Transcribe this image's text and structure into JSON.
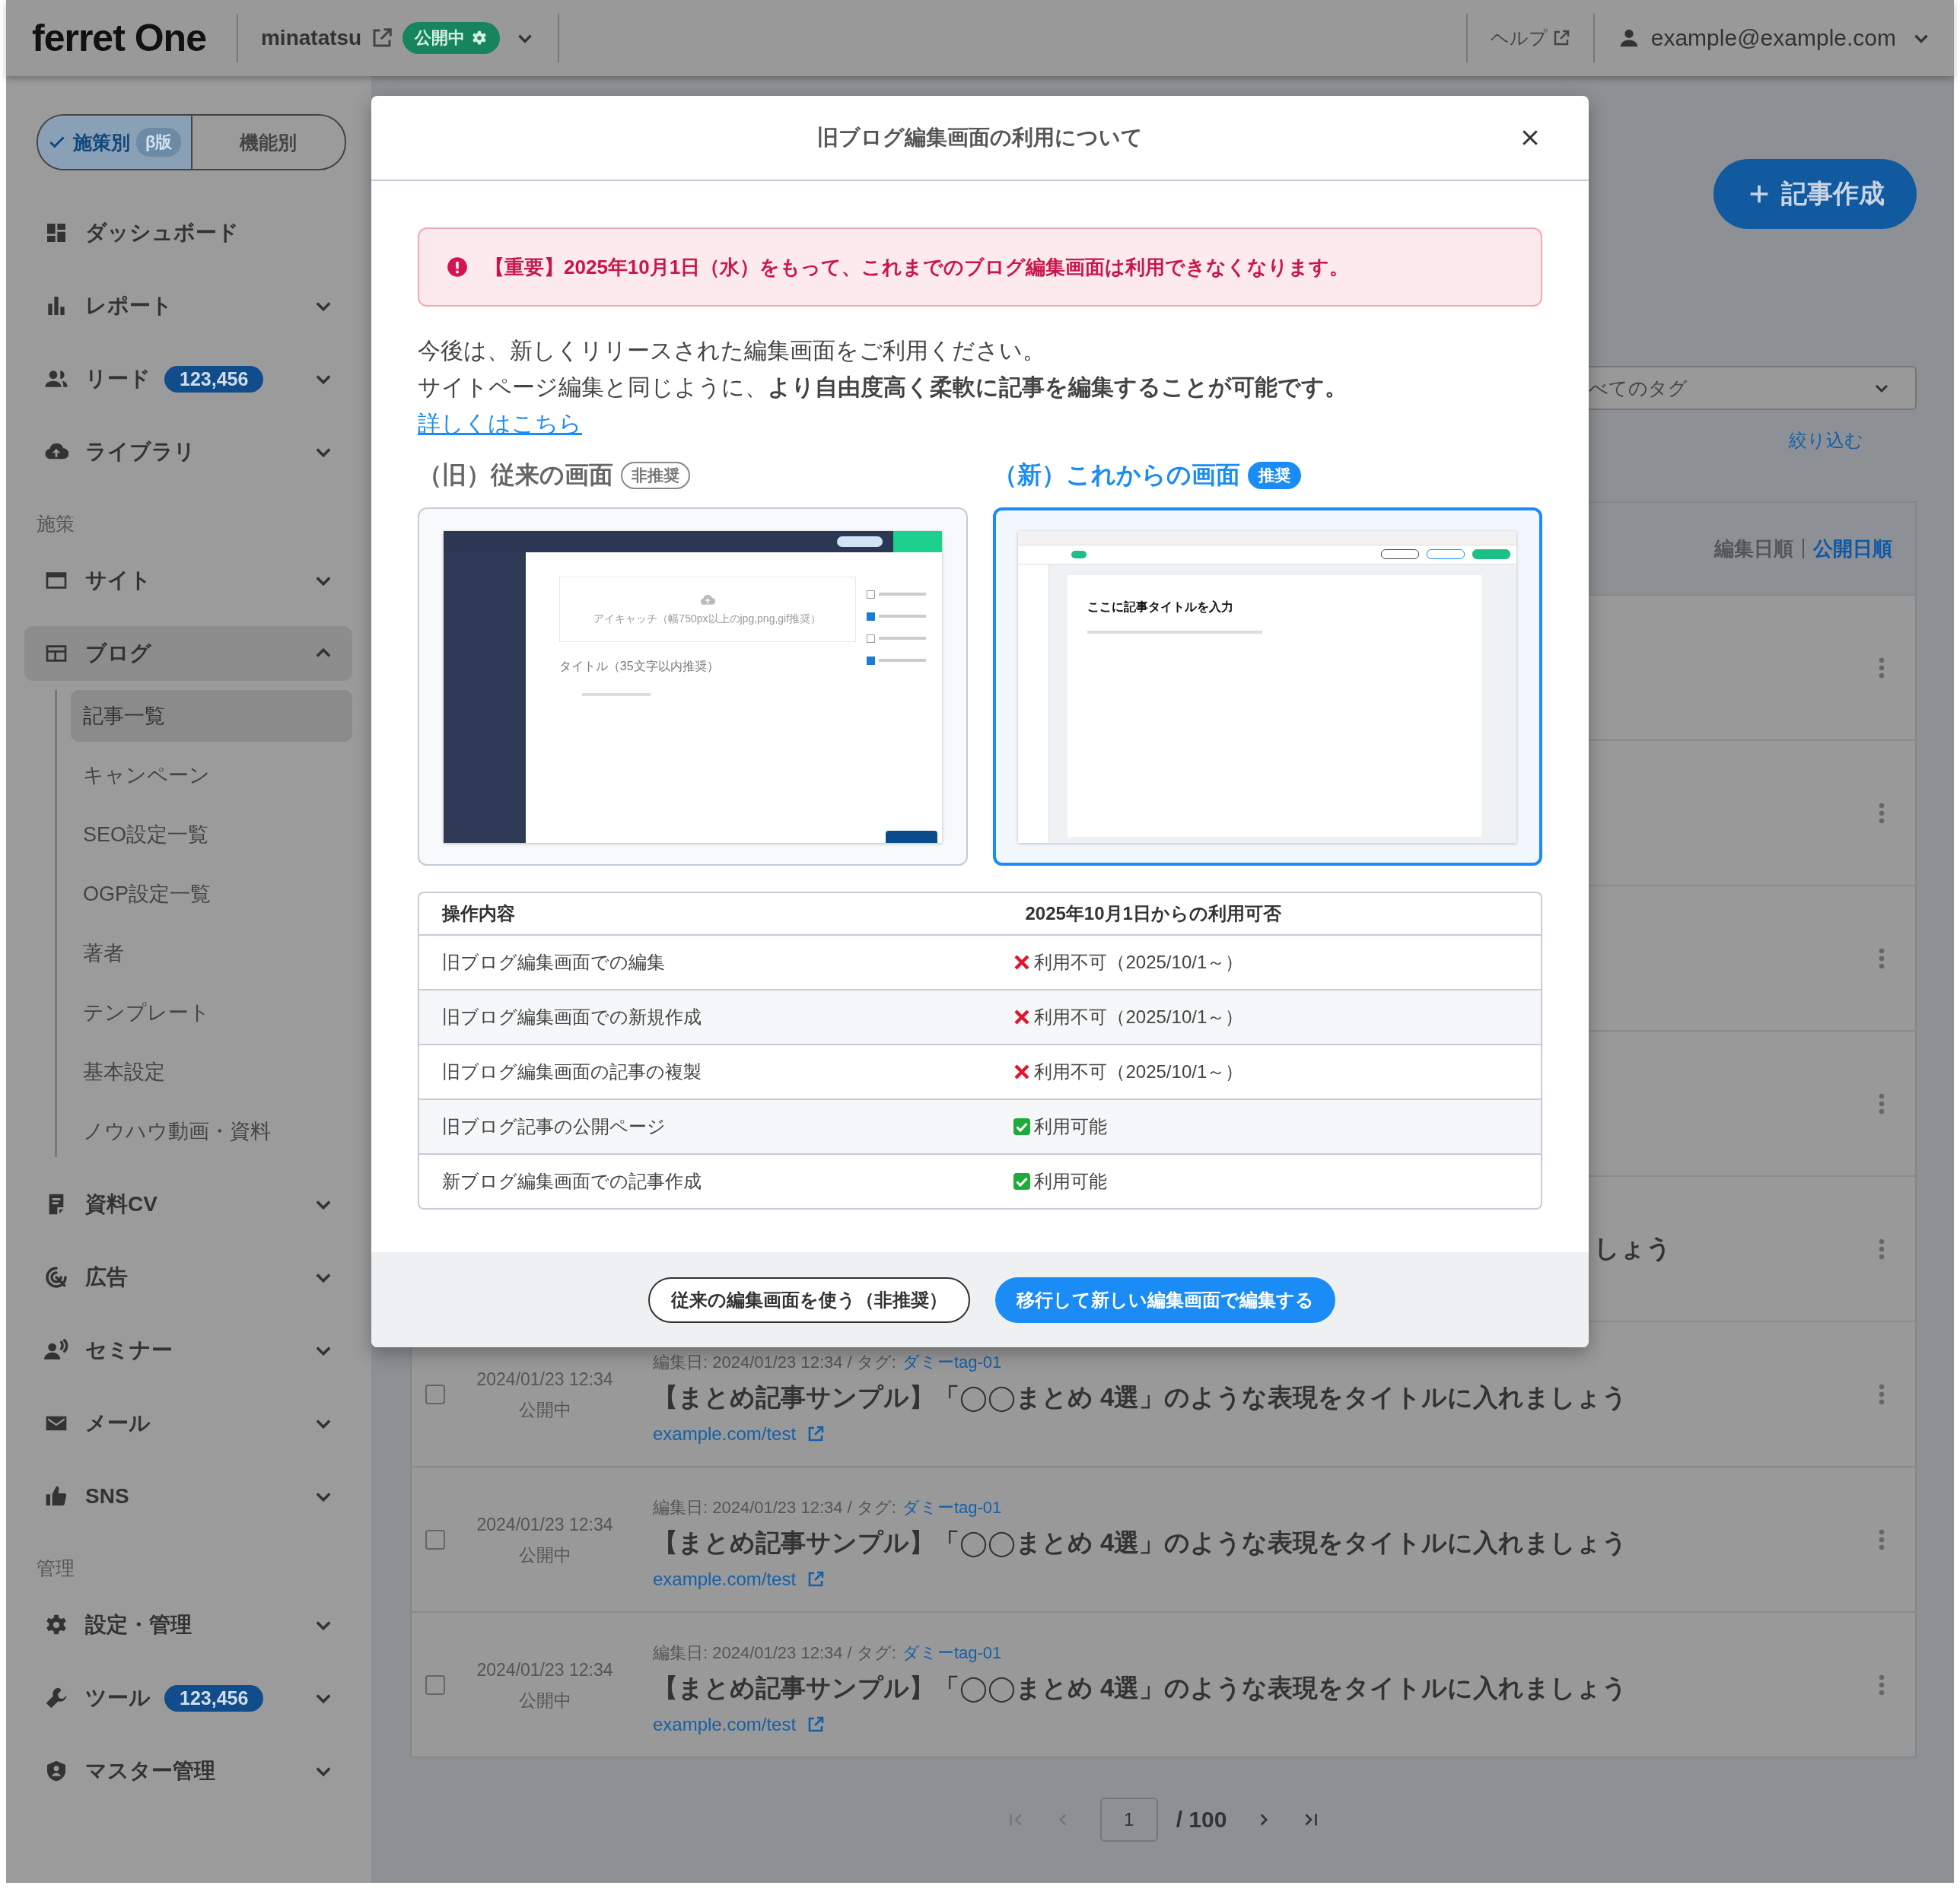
{
  "topbar": {
    "logo": "ferret One",
    "site": "minatatsu",
    "status_badge": "公開中",
    "help": "ヘルプ",
    "user": "example@example.com"
  },
  "sidebar": {
    "mode_tabs": [
      {
        "label": "施策別",
        "badge": "β版",
        "selected": true
      },
      {
        "label": "機能別",
        "selected": false
      }
    ],
    "items": [
      {
        "kind": "item",
        "label": "ダッシュボード"
      },
      {
        "kind": "item",
        "label": "レポート",
        "expanded": false
      },
      {
        "kind": "item",
        "label": "リード",
        "badge": "123,456",
        "expanded": false
      },
      {
        "kind": "item",
        "label": "ライブラリ",
        "expanded": false
      },
      {
        "kind": "section",
        "label": "施策"
      },
      {
        "kind": "item",
        "label": "サイト",
        "expanded": false
      },
      {
        "kind": "item",
        "label": "ブログ",
        "expanded": true,
        "children": [
          {
            "label": "記事一覧",
            "selected": true
          },
          {
            "label": "キャンペーン",
            "selected": false
          },
          {
            "label": "SEO設定一覧",
            "selected": false
          },
          {
            "label": "OGP設定一覧",
            "selected": false
          },
          {
            "label": "著者",
            "selected": false
          },
          {
            "label": "テンプレート",
            "selected": false
          },
          {
            "label": "基本設定",
            "selected": false
          },
          {
            "label": "ノウハウ動画・資料",
            "selected": false
          }
        ]
      },
      {
        "kind": "item",
        "label": "資料CV",
        "expanded": false
      },
      {
        "kind": "item",
        "label": "広告",
        "expanded": false
      },
      {
        "kind": "item",
        "label": "セミナー",
        "expanded": false
      },
      {
        "kind": "item",
        "label": "メール",
        "expanded": false
      },
      {
        "kind": "item",
        "label": "SNS",
        "expanded": false
      },
      {
        "kind": "section",
        "label": "管理"
      },
      {
        "kind": "item",
        "label": "設定・管理",
        "expanded": false
      },
      {
        "kind": "item",
        "label": "ツール",
        "badge": "123,456",
        "expanded": false
      },
      {
        "kind": "item",
        "label": "マスター管理",
        "expanded": false
      }
    ]
  },
  "main": {
    "create_button": "記事作成",
    "tag_filter": "べてのタグ",
    "filter_link": "絞り込む",
    "sort": [
      {
        "label": "編集日順",
        "selected": false
      },
      {
        "label": "公開日順",
        "selected": true
      }
    ],
    "rows": [
      {
        "kind": "covered"
      },
      {
        "kind": "covered"
      },
      {
        "kind": "covered"
      },
      {
        "kind": "covered"
      },
      {
        "kind": "covered",
        "title": "しょう"
      },
      {
        "kind": "full",
        "checked": false,
        "date": "2024/01/23  12:34",
        "status": "公開中",
        "edited": "編集日: 2024/01/23  12:34  / タグ:",
        "tag": "ダミーtag-01",
        "title": "【まとめ記事サンプル】「◯◯まとめ 4選」のような表現をタイトルに入れましょう",
        "url": "example.com/test"
      },
      {
        "kind": "full",
        "checked": false,
        "date": "2024/01/23  12:34",
        "status": "公開中",
        "edited": "編集日: 2024/01/23  12:34  / タグ:",
        "tag": "ダミーtag-01",
        "title": "【まとめ記事サンプル】「◯◯まとめ 4選」のような表現をタイトルに入れましょう",
        "url": "example.com/test"
      },
      {
        "kind": "full",
        "checked": false,
        "date": "2024/01/23  12:34",
        "status": "公開中",
        "edited": "編集日: 2024/01/23  12:34  / タグ:",
        "tag": "ダミーtag-01",
        "title": "【まとめ記事サンプル】「◯◯まとめ 4選」のような表現をタイトルに入れましょう",
        "url": "example.com/test"
      }
    ],
    "pagination": {
      "page": "1",
      "total": "/ 100"
    }
  },
  "modal": {
    "title": "旧ブログ編集画面の利用について",
    "alert": "【重要】2025年10月1日（水）をもって、これまでのブログ編集画面は利用できなくなります。",
    "intro": [
      "今後は、新しくリリースされた編集画面をご利用ください。",
      "サイトページ編集と同じように、**より自由度高く柔軟に記事を編集することが可能です。**"
    ],
    "more_link": "詳しくはこちら",
    "options": [
      {
        "heading": "（旧）従来の画面",
        "badge": "非推奨",
        "selected": false,
        "preview": {
          "kind": "legacy",
          "eyecatch": "アイキャッチ（幅750px以上のjpg,png,gif推奨）",
          "title_placeholder": "タイトル（35文字以内推奨）",
          "checks": [
            {
              "checked": false
            },
            {
              "checked": true
            },
            {
              "checked": false
            },
            {
              "checked": true
            }
          ]
        }
      },
      {
        "heading": "（新）これからの画面",
        "badge": "推奨",
        "selected": true,
        "preview": {
          "kind": "blocks",
          "highlight": {
            "on": true
          },
          "title_placeholder": "ここに記事タイトルを入力"
        }
      }
    ],
    "table": {
      "columns": [
        "操作内容",
        "2025年10月1日からの利用可否"
      ],
      "rows": [
        {
          "operation": "旧ブログ編集画面での編集",
          "available": false,
          "result": "利用不可（2025/10/1～）"
        },
        {
          "operation": "旧ブログ編集画面での新規作成",
          "available": false,
          "result": "利用不可（2025/10/1～）"
        },
        {
          "operation": "旧ブログ編集画面の記事の複製",
          "available": false,
          "result": "利用不可（2025/10/1～）"
        },
        {
          "operation": "旧ブログ記事の公開ページ",
          "available": true,
          "result": "利用可能"
        },
        {
          "operation": "新ブログ編集画面での記事作成",
          "available": true,
          "result": "利用可能"
        }
      ]
    },
    "buttons": [
      {
        "label": "従来の編集画面を使う（非推奨）",
        "kind": "secondary"
      },
      {
        "label": "移行して新しい編集画面で編集する",
        "kind": "primary"
      }
    ]
  }
}
